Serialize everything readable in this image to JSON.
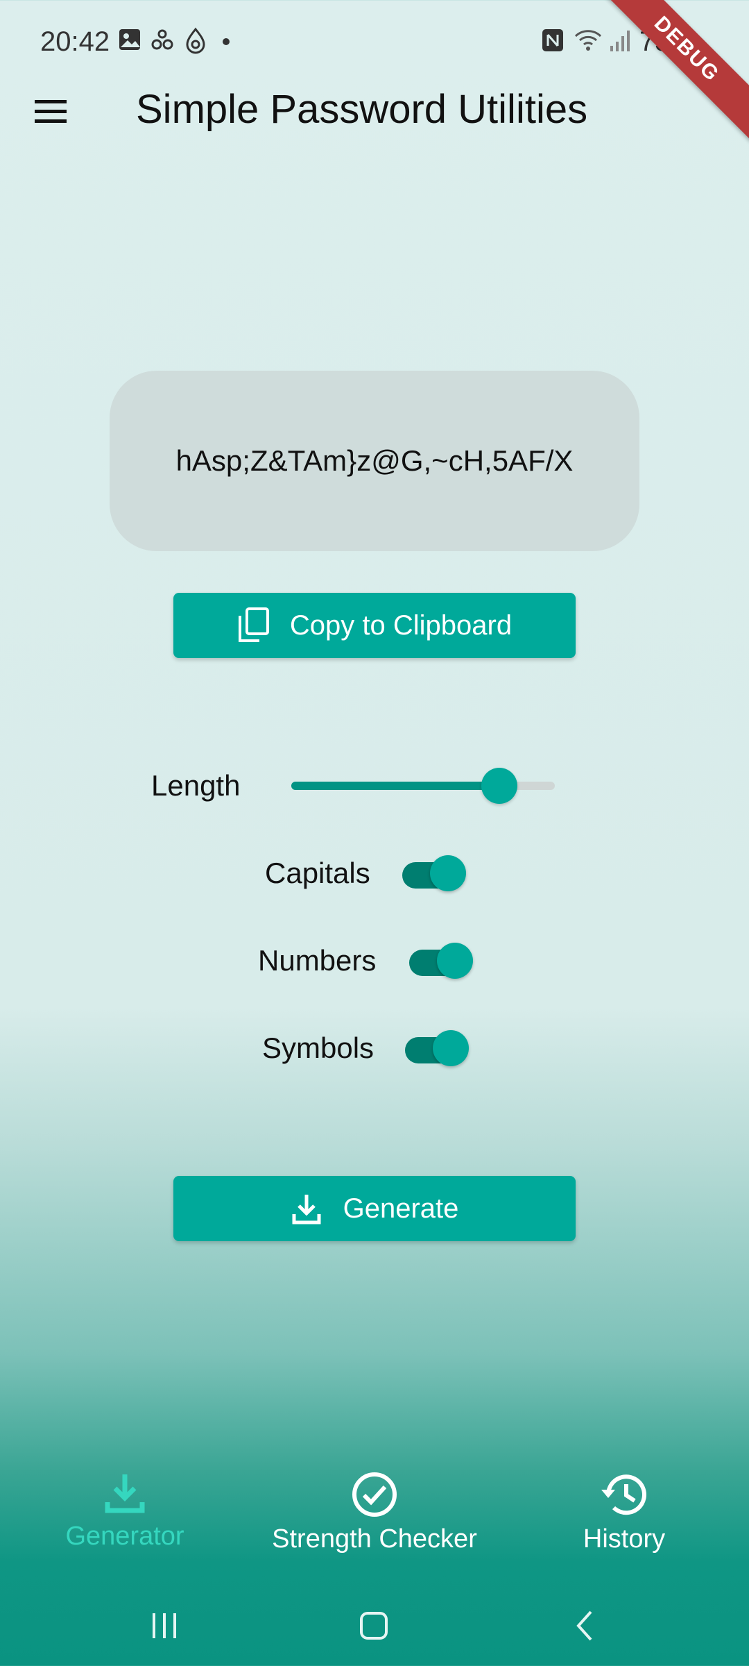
{
  "status_bar": {
    "time": "20:42",
    "battery": "73%",
    "icons": [
      "image-icon",
      "drops-icon",
      "drop-target-icon",
      "dot-icon",
      "nfc-icon",
      "wifi-icon",
      "signal-icon",
      "battery-icon"
    ]
  },
  "debug_ribbon": "DEBUG",
  "app_bar": {
    "title": "Simple Password Utilities",
    "menu_icon": "hamburger-menu-icon"
  },
  "password": {
    "value": "hAsp;Z&TAm}z@G,~cH,5AF/X"
  },
  "copy_button": {
    "label": "Copy to Clipboard",
    "icon": "copy-icon"
  },
  "options": {
    "length_label": "Length",
    "length_fraction": 0.79,
    "capitals_label": "Capitals",
    "capitals_on": true,
    "numbers_label": "Numbers",
    "numbers_on": true,
    "symbols_label": "Symbols",
    "symbols_on": true
  },
  "generate_button": {
    "label": "Generate",
    "icon": "download-icon"
  },
  "bottom_nav": {
    "items": [
      {
        "label": "Generator",
        "icon": "download-icon",
        "active": true
      },
      {
        "label": "Strength Checker",
        "icon": "check-circle-icon",
        "active": false
      },
      {
        "label": "History",
        "icon": "history-icon",
        "active": false
      }
    ]
  },
  "colors": {
    "accent": "#00a99a",
    "active_nav": "#35d7bf",
    "debug_ribbon": "#b53a3a"
  }
}
